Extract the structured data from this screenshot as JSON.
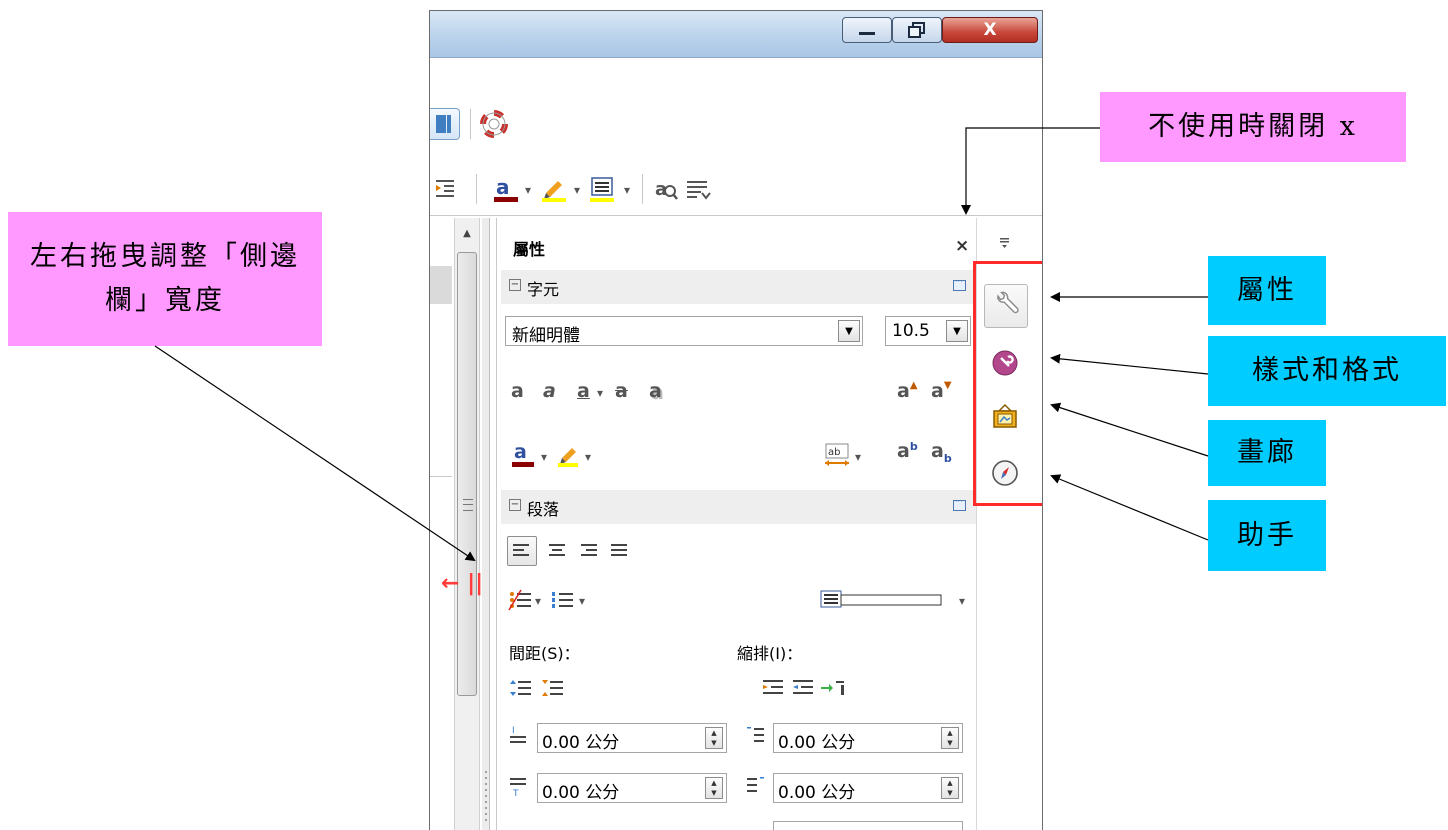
{
  "window": {
    "close_glyph": "X"
  },
  "sidebar": {
    "title": "屬性",
    "close_glyph": "×",
    "drag_hint": "← ||",
    "character": {
      "header": "字元",
      "font_name": "新細明體",
      "font_size": "10.5",
      "row1_glyphs": [
        "a",
        "a",
        "a",
        "a",
        "a"
      ],
      "grow_glyph": "a",
      "shrink_glyph": "a",
      "superscript_glyph": "a",
      "subscript_glyph": "a",
      "fontcolor_glyph": "a"
    },
    "paragraph": {
      "header": "段落",
      "spacing_label": "間距(S)：",
      "indent_label": "縮排(I)：",
      "above_spacing": "0.00 公分",
      "below_spacing": "0.00 公分",
      "before_indent": "0.00 公分",
      "after_indent": "0.00 公分"
    }
  },
  "callouts": {
    "resize": "左右拖曳調整「側邊欄」寬度",
    "close_when_unused": "不使用時關閉 x",
    "properties": "屬性",
    "styles": "樣式和格式",
    "gallery": "畫廊",
    "navigator": "助手"
  },
  "colors": {
    "callout_pink": "#ff99ff",
    "callout_blue": "#00ccff",
    "highlight_red": "#ff2b2b"
  }
}
